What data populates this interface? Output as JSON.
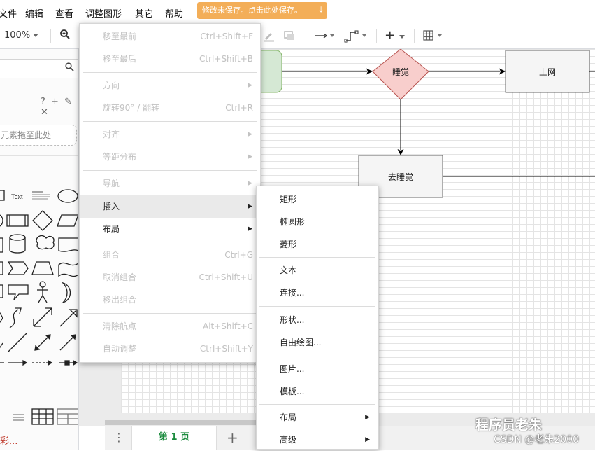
{
  "menubar": {
    "items": [
      "文件",
      "编辑",
      "查看",
      "调整图形",
      "其它",
      "帮助"
    ],
    "save_notice": "修改未保存。点击此处保存。",
    "save_icon": "download-icon"
  },
  "toolbar": {
    "zoom": "100%",
    "zoom_in_icon": "zoom-in-icon",
    "pencil_icon": "line-color-icon",
    "shadow_icon": "shadow-icon",
    "connection_icon": "arrow-right-icon",
    "waypoint_icon": "waypoint-icon",
    "insert_icon": "plus-icon",
    "table_icon": "table-icon"
  },
  "sidebar": {
    "scratchpad_tools": "? + ✎ ✕",
    "drop_hint": "元素拖至此处",
    "bottom_text": "彩..."
  },
  "diagram": {
    "nodes": [
      "睡觉",
      "上网",
      "去睡觉"
    ]
  },
  "pagebar": {
    "page_tab": "第 1 页",
    "add_label": "+",
    "menu_label": "⋮"
  },
  "main_menu": {
    "items": [
      {
        "label": "移至最前",
        "shortcut": "Ctrl+Shift+F",
        "enabled": false,
        "submenu": false
      },
      {
        "label": "移至最后",
        "shortcut": "Ctrl+Shift+B",
        "enabled": false,
        "submenu": false
      },
      {
        "label": "方向",
        "shortcut": "",
        "enabled": false,
        "submenu": true
      },
      {
        "label": "旋转90° / 翻转",
        "shortcut": "Ctrl+R",
        "enabled": false,
        "submenu": false
      },
      {
        "label": "对齐",
        "shortcut": "",
        "enabled": false,
        "submenu": true
      },
      {
        "label": "等距分布",
        "shortcut": "",
        "enabled": false,
        "submenu": true
      },
      {
        "label": "导航",
        "shortcut": "",
        "enabled": false,
        "submenu": true
      },
      {
        "label": "插入",
        "shortcut": "",
        "enabled": true,
        "submenu": true,
        "active": true
      },
      {
        "label": "布局",
        "shortcut": "",
        "enabled": true,
        "submenu": true
      },
      {
        "label": "组合",
        "shortcut": "Ctrl+G",
        "enabled": false,
        "submenu": false
      },
      {
        "label": "取消组合",
        "shortcut": "Ctrl+Shift+U",
        "enabled": false,
        "submenu": false
      },
      {
        "label": "移出组合",
        "shortcut": "",
        "enabled": false,
        "submenu": false
      },
      {
        "label": "清除航点",
        "shortcut": "Alt+Shift+C",
        "enabled": false,
        "submenu": false
      },
      {
        "label": "自动调整",
        "shortcut": "Ctrl+Shift+Y",
        "enabled": false,
        "submenu": false
      }
    ]
  },
  "insert_submenu": {
    "items": [
      {
        "label": "矩形",
        "submenu": false
      },
      {
        "label": "椭圆形",
        "submenu": false
      },
      {
        "label": "菱形",
        "submenu": false
      },
      {
        "label": "文本",
        "submenu": false
      },
      {
        "label": "连接...",
        "submenu": false
      },
      {
        "label": "形状...",
        "submenu": false
      },
      {
        "label": "自由绘图...",
        "submenu": false
      },
      {
        "label": "图片...",
        "submenu": false
      },
      {
        "label": "模板...",
        "submenu": false
      },
      {
        "label": "布局",
        "submenu": true
      },
      {
        "label": "高级",
        "submenu": true
      }
    ]
  },
  "watermark": {
    "line1": "程序员老朱",
    "line2": "CSDN @老朱2000"
  },
  "colors": {
    "save_notice_bg": "#f3ae58",
    "page_tab_text": "#1a8b3d",
    "diamond_fill": "#f8cecc",
    "diamond_stroke": "#b85450",
    "green_fill": "#d5e8d4",
    "green_stroke": "#82b366"
  }
}
